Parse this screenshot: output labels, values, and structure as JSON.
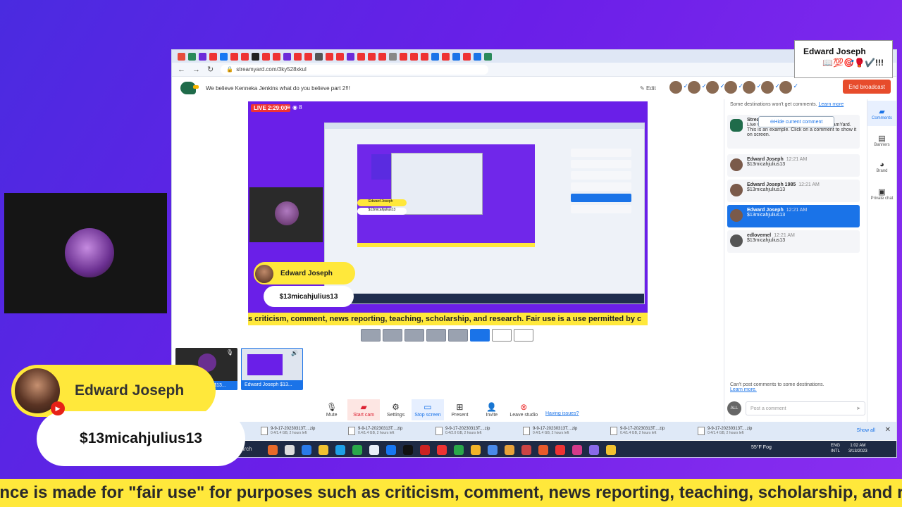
{
  "browser": {
    "url": "streamyard.com/3ky528xkul",
    "broadcast_title": "We believe Kenneka Jenkins what do you believe part 2!!!",
    "edit_label": "Edit",
    "end_broadcast_label": "End broadcast"
  },
  "stage": {
    "live_label": "LIVE 2:29:00",
    "viewer_count": "8",
    "banner_name": "Edward Joseph",
    "banner_handle": "$13micahjulius13",
    "ticker_text": "s criticism, comment, news reporting, teaching, scholarship, and research. Fair use is a use permitted by c"
  },
  "thumbnails": [
    {
      "caption": "Edward Joseph $13..."
    },
    {
      "caption": "Edward Joseph $13..."
    }
  ],
  "controls": [
    {
      "label": "Mute",
      "icon": "mic-icon"
    },
    {
      "label": "Start cam",
      "icon": "camera-off-icon"
    },
    {
      "label": "Settings",
      "icon": "gear-icon"
    },
    {
      "label": "Stop screen",
      "icon": "screen-share-icon"
    },
    {
      "label": "Present",
      "icon": "present-icon"
    },
    {
      "label": "Invite",
      "icon": "add-person-icon"
    },
    {
      "label": "Leave studio",
      "icon": "leave-icon"
    }
  ],
  "having_issues": "Having issues?",
  "chat": {
    "top_note": "Some destinations won't get comments.",
    "learn_more": "Learn more",
    "hide_comment": "Hide current comment",
    "streamyard_name": "Stream",
    "streamyard_text": "Live viewer comments show up on StreamYard. This is an example. Click on a comment to show it on screen.",
    "messages": [
      {
        "name": "Edward Joseph",
        "time": "12:21 AM",
        "text": "$13micahjulius13"
      },
      {
        "name": "Edward Joseph 1985",
        "time": "12:21 AM",
        "text": "$13micahjulius13"
      },
      {
        "name": "Edward Joseph",
        "time": "12:21 AM",
        "text": "$13micahjulius13"
      },
      {
        "name": "edlovemel",
        "time": "12:21 AM",
        "text": "$13micahjulius13"
      }
    ],
    "cant_post": "Can't post comments to some destinations.",
    "cant_learn_more": "Learn more.",
    "all_badge": "ALL",
    "post_placeholder": "Post a comment"
  },
  "rail": [
    {
      "label": "Comments",
      "icon": "comment-icon"
    },
    {
      "label": "Banners",
      "icon": "banner-icon"
    },
    {
      "label": "Brand",
      "icon": "palette-icon"
    },
    {
      "label": "Private chat",
      "icon": "chat-icon"
    }
  ],
  "downloads": [
    {
      "name": "9-9-17-20230313T....zip",
      "status": "0.4/1.4 GB, 2 hours left"
    },
    {
      "name": "9-9-17-20230313T....zip",
      "status": "0.4/1.4 GB, 2 hours left"
    },
    {
      "name": "9-9-17-20230313T....zip",
      "status": "0.4/2.0 GB, 2 hours left"
    },
    {
      "name": "9-9-17-20230313T....zip",
      "status": "0.4/1.4 GB, 2 hours left"
    },
    {
      "name": "9-9-17-20230313T....zip",
      "status": "0.4/1.4 GB, 2 hours left"
    },
    {
      "name": "9-9-17-20230313T....zip",
      "status": "0.4/1.4 GB, 2 hours left"
    }
  ],
  "show_all": "Show all",
  "taskbar": {
    "search": "arch",
    "weather": "55°F  Fog",
    "lang_top": "ENG",
    "lang_bottom": "INTL",
    "time": "1:02 AM",
    "date": "3/13/2023"
  },
  "name_tag": {
    "name": "Edward Joseph",
    "emoji": "📖💯🎯🥊✔️!!!"
  },
  "lower_third": {
    "name": "Edward Joseph",
    "handle": "$13micahjulius13"
  },
  "ticker": "ance is made for \"fair use\" for purposes such as criticism, comment, news reporting, teaching, scholarship, and research."
}
